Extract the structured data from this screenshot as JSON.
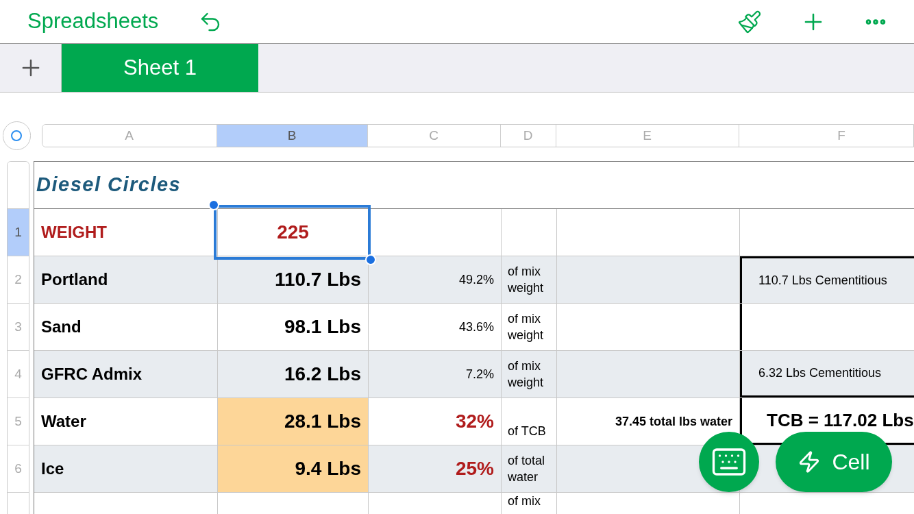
{
  "toolbar": {
    "title": "Spreadsheets"
  },
  "sheet_tabs": [
    {
      "label": "Sheet 1",
      "selected": true
    }
  ],
  "columns": [
    {
      "label": "A",
      "selected": false
    },
    {
      "label": "B",
      "selected": true
    },
    {
      "label": "C",
      "selected": false
    },
    {
      "label": "D",
      "selected": false
    },
    {
      "label": "E",
      "selected": false
    },
    {
      "label": "F",
      "selected": false
    }
  ],
  "table_title": "Diesel Circles",
  "rows": [
    {
      "number": "1",
      "selected": true,
      "cells": [
        {
          "kind": "label",
          "text": "WEIGHT",
          "alert": true,
          "selected": false
        },
        {
          "kind": "amount",
          "text": "225",
          "alert": true,
          "selected": true
        },
        null,
        null,
        null,
        null
      ]
    },
    {
      "number": "2",
      "selected": false,
      "cells": [
        {
          "kind": "label",
          "text": "Portland",
          "selected": false
        },
        {
          "kind": "amount",
          "text": "110.7 Lbs",
          "selected": false
        },
        {
          "kind": "percent",
          "text": "49.2%",
          "selected": false
        },
        {
          "kind": "note",
          "text": "of mix weight",
          "selected": false
        },
        null,
        {
          "kind": "summary",
          "text": "110.7 Lbs Cementitious",
          "selected": false
        }
      ]
    },
    {
      "number": "3",
      "selected": false,
      "cells": [
        {
          "kind": "label",
          "text": "Sand",
          "selected": false
        },
        {
          "kind": "amount",
          "text": "98.1 Lbs",
          "selected": false
        },
        {
          "kind": "percent",
          "text": "43.6%",
          "selected": false
        },
        {
          "kind": "note",
          "text": "of mix weight",
          "selected": false
        },
        null,
        null
      ]
    },
    {
      "number": "4",
      "selected": false,
      "cells": [
        {
          "kind": "label",
          "text": "GFRC Admix",
          "selected": false
        },
        {
          "kind": "amount",
          "text": "16.2 Lbs",
          "selected": false
        },
        {
          "kind": "percent",
          "text": "7.2%",
          "selected": false
        },
        {
          "kind": "note",
          "text": "of mix weight",
          "selected": false
        },
        null,
        {
          "kind": "summary",
          "text": "6.32 Lbs Cementitious",
          "selected": false
        }
      ]
    },
    {
      "number": "5",
      "selected": false,
      "cells": [
        {
          "kind": "label",
          "text": "Water",
          "selected": false
        },
        {
          "kind": "amount",
          "text": "28.1 Lbs",
          "highlight": true,
          "selected": false
        },
        {
          "kind": "percent",
          "text": "32%",
          "alert": true,
          "selected": false
        },
        {
          "kind": "note",
          "text": "of TCB",
          "selected": false
        },
        {
          "kind": "total",
          "text": "37.45 total lbs water",
          "selected": false
        },
        {
          "kind": "summary",
          "text": "TCB = 117.02 Lbs",
          "emphasis": true,
          "selected": false
        }
      ]
    },
    {
      "number": "6",
      "selected": false,
      "cells": [
        {
          "kind": "label",
          "text": "Ice",
          "selected": false
        },
        {
          "kind": "amount",
          "text": "9.4 Lbs",
          "highlight": true,
          "selected": false
        },
        {
          "kind": "percent",
          "text": "25%",
          "alert": true,
          "selected": false
        },
        {
          "kind": "note",
          "text": "of total water",
          "selected": false
        },
        null,
        null
      ]
    },
    {
      "selected": false,
      "cells": [
        null,
        null,
        null,
        {
          "kind": "note",
          "text": "of mix",
          "selected": false
        },
        null,
        null
      ]
    }
  ],
  "floating_buttons": [
    {
      "kind": "keyboard"
    },
    {
      "kind": "cell",
      "label": "Cell"
    }
  ]
}
